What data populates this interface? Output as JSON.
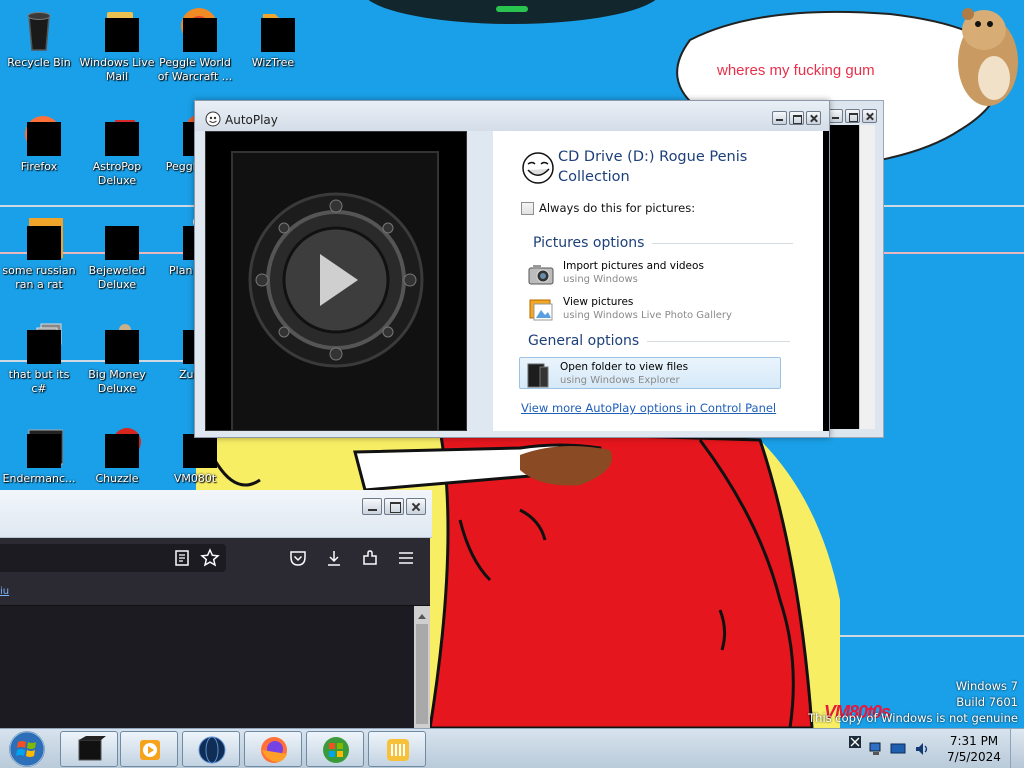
{
  "desktop": {
    "icons": [
      {
        "label": "Recycle Bin"
      },
      {
        "label": "Windows Live Mail"
      },
      {
        "label": "Peggle World of Warcraft ..."
      },
      {
        "label": "WizTree"
      },
      {
        "label": "Firefox"
      },
      {
        "label": "AstroPop Deluxe"
      },
      {
        "label": "Peggle Del"
      },
      {
        "label": "some russian ran a rat"
      },
      {
        "label": "Bejeweled Deluxe"
      },
      {
        "label": "Plan Zom"
      },
      {
        "label": "that but its c#"
      },
      {
        "label": "Big Money Deluxe"
      },
      {
        "label": "Zuma"
      },
      {
        "label": "Endermanc..."
      },
      {
        "label": "Chuzzle"
      },
      {
        "label": "VM080t"
      }
    ],
    "bubble_text": "wheres my fucking gum"
  },
  "autoplay": {
    "title": "AutoPlay",
    "drive_title": "CD Drive (D:) Rogue Penis Collection",
    "always_label": "Always do this for pictures:",
    "pictures_heading": "Pictures options",
    "general_heading": "General options",
    "options": [
      {
        "title": "Import pictures and videos",
        "sub": "using Windows"
      },
      {
        "title": "View pictures",
        "sub": "using Windows Live Photo Gallery"
      },
      {
        "title": "Open folder to view files",
        "sub": "using Windows Explorer"
      }
    ],
    "more_link": "View more AutoPlay options in Control Panel"
  },
  "browser": {
    "bookmark_fragment": "iu"
  },
  "watermark": {
    "line1": "Windows 7",
    "line2": "Build 7601",
    "line3": "This copy of Windows is not genuine",
    "vm_logo": "VM80t0s"
  },
  "taskbar": {
    "time": "7:31 PM",
    "date": "7/5/2024"
  },
  "colors": {
    "wallpaper": "#1aa0e8",
    "bubble_text": "#e8304a",
    "link": "#1f5fb8",
    "heading": "#1d3f7a"
  }
}
